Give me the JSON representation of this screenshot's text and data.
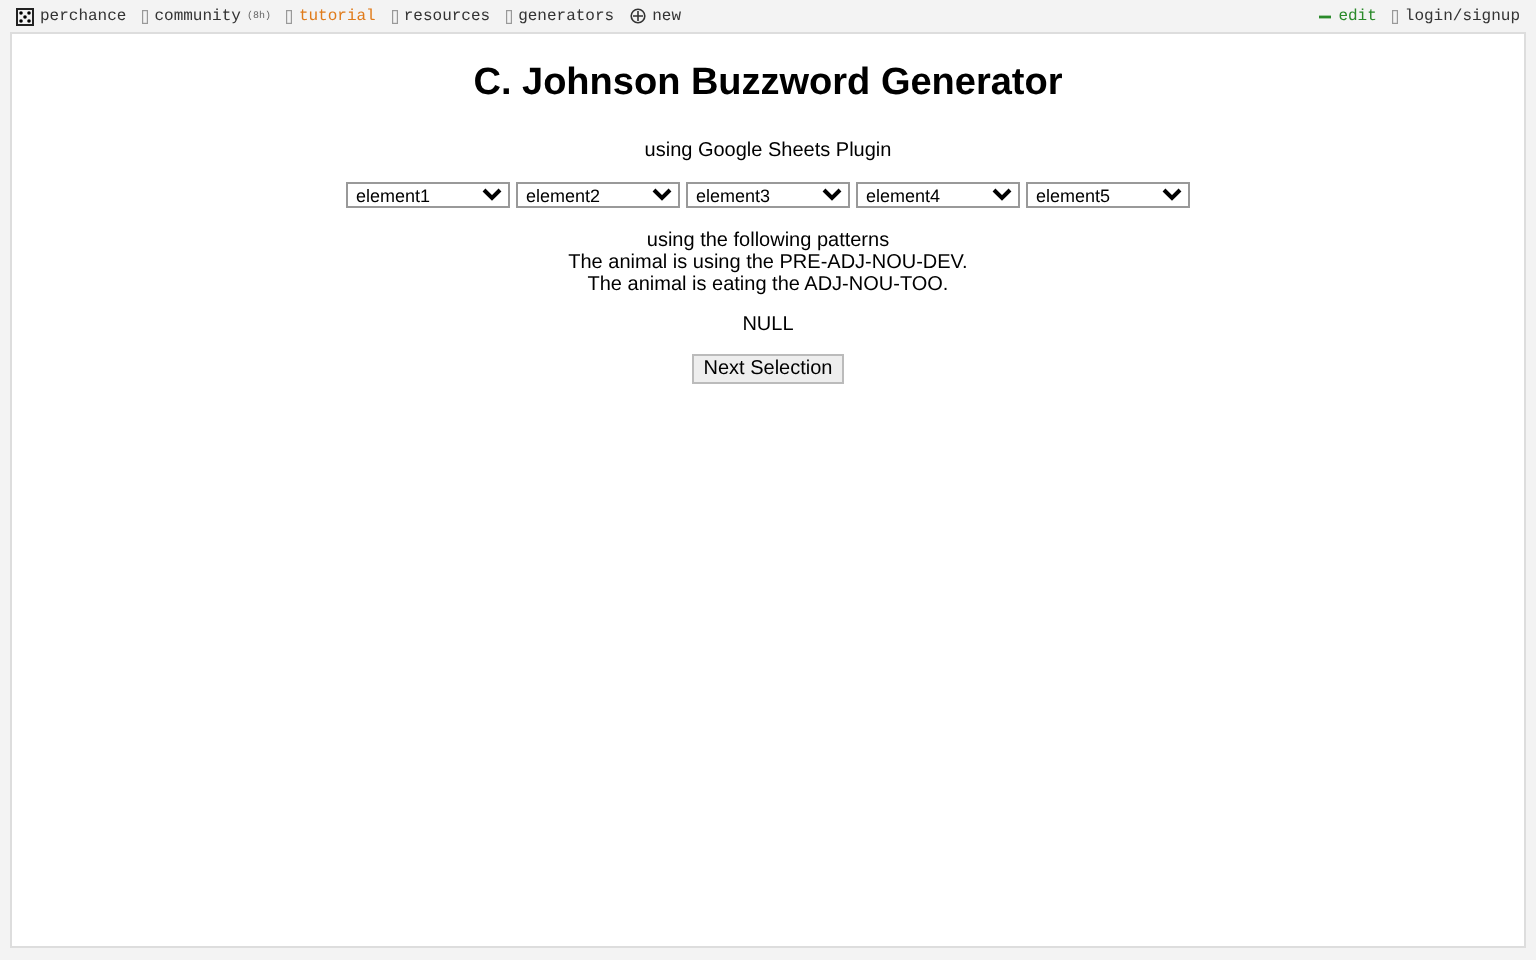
{
  "nav": {
    "left": [
      {
        "label": "perchance",
        "kind": "plain"
      },
      {
        "label": "community",
        "kind": "plain",
        "badge": "(8h)"
      },
      {
        "label": "tutorial",
        "kind": "highlight"
      },
      {
        "label": "resources",
        "kind": "plain"
      },
      {
        "label": "generators",
        "kind": "plain"
      },
      {
        "label": "new",
        "kind": "plain"
      }
    ],
    "right": [
      {
        "label": "edit",
        "kind": "edit"
      },
      {
        "label": "login/signup",
        "kind": "plain"
      }
    ]
  },
  "page": {
    "title": "C. Johnson Buzzword Generator",
    "subtitle": "using Google Sheets Plugin",
    "selects": [
      "element1",
      "element2",
      "element3",
      "element4",
      "element5"
    ],
    "pattern_lines": [
      "using the following patterns",
      "The animal is using the PRE-ADJ-NOU-DEV.",
      "The animal is eating the ADJ-NOU-TOO."
    ],
    "result": "NULL",
    "button": "Next Selection"
  }
}
